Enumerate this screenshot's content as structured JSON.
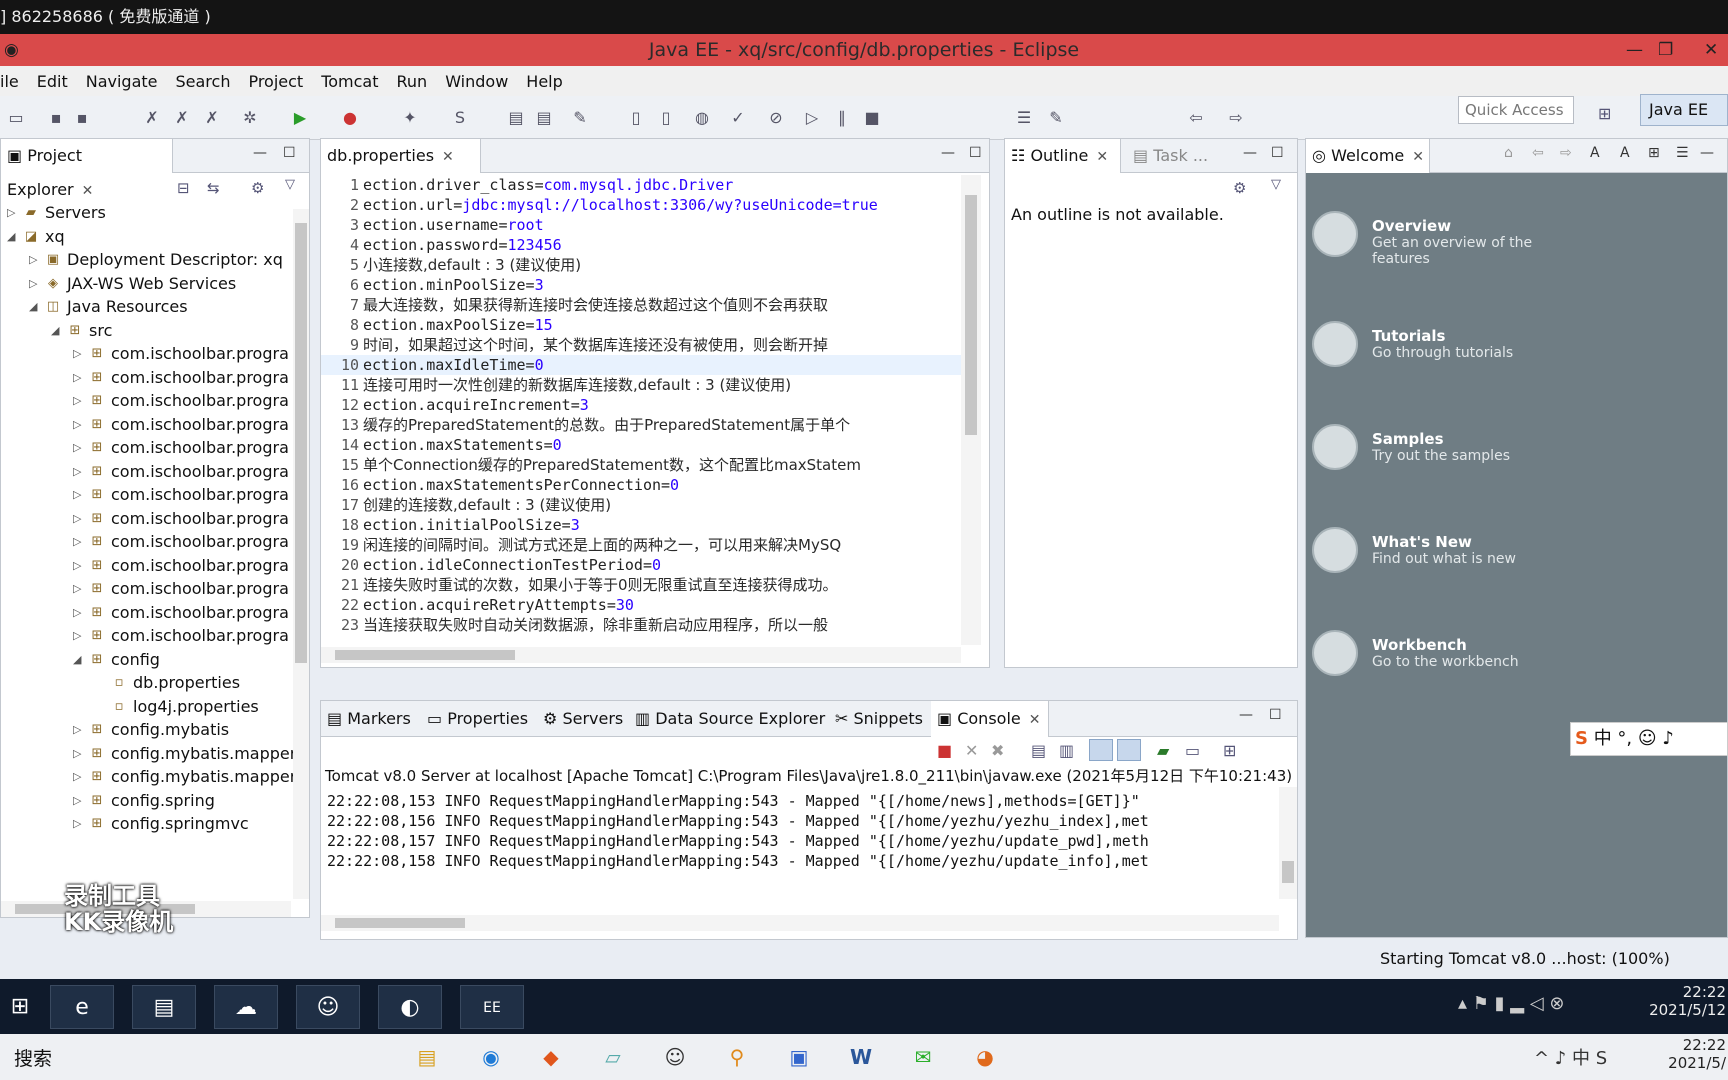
{
  "top_strip": {
    "text": "] 862258686 ( 免费版通道 )"
  },
  "window": {
    "title": "Java EE - xq/src/config/db.properties - Eclipse"
  },
  "menu": [
    "ile",
    "Edit",
    "Navigate",
    "Search",
    "Project",
    "Tomcat",
    "Run",
    "Window",
    "Help"
  ],
  "toolbar": {
    "quick_access_placeholder": "Quick Access",
    "perspective": "Java EE"
  },
  "project_explorer": {
    "tab": "Project Explorer",
    "items": [
      {
        "label": "Servers",
        "icon": "folder-icon"
      },
      {
        "label": "xq",
        "icon": "project-icon"
      },
      {
        "label": "Deployment Descriptor: xq",
        "icon": "descriptor-icon"
      },
      {
        "label": "JAX-WS Web Services",
        "icon": "webservice-icon"
      },
      {
        "label": "Java Resources",
        "icon": "java-resources-icon"
      },
      {
        "label": "src",
        "icon": "source-folder-icon"
      },
      {
        "label": "com.ischoolbar.progra",
        "icon": "package-icon"
      },
      {
        "label": "com.ischoolbar.progra",
        "icon": "package-icon"
      },
      {
        "label": "com.ischoolbar.progra",
        "icon": "package-icon"
      },
      {
        "label": "com.ischoolbar.progra",
        "icon": "package-icon"
      },
      {
        "label": "com.ischoolbar.progra",
        "icon": "package-icon"
      },
      {
        "label": "com.ischoolbar.progra",
        "icon": "package-icon"
      },
      {
        "label": "com.ischoolbar.progra",
        "icon": "package-icon"
      },
      {
        "label": "com.ischoolbar.progra",
        "icon": "package-icon"
      },
      {
        "label": "com.ischoolbar.progra",
        "icon": "package-icon"
      },
      {
        "label": "com.ischoolbar.progra",
        "icon": "package-icon"
      },
      {
        "label": "com.ischoolbar.progra",
        "icon": "package-icon"
      },
      {
        "label": "com.ischoolbar.progra",
        "icon": "package-icon"
      },
      {
        "label": "com.ischoolbar.progra",
        "icon": "package-icon"
      },
      {
        "label": "config",
        "icon": "package-icon"
      },
      {
        "label": "db.properties",
        "icon": "file-icon"
      },
      {
        "label": "log4j.properties",
        "icon": "file-icon"
      },
      {
        "label": "config.mybatis",
        "icon": "package-icon"
      },
      {
        "label": "config.mybatis.mapper",
        "icon": "package-icon"
      },
      {
        "label": "config.mybatis.mapper",
        "icon": "package-icon"
      },
      {
        "label": "config.spring",
        "icon": "package-icon"
      },
      {
        "label": "config.springmvc",
        "icon": "package-icon"
      }
    ]
  },
  "editor": {
    "tab": "db.properties",
    "lines": [
      {
        "n": "1",
        "k": "ection.driver_class=",
        "v": "com.mysql.jdbc.Driver"
      },
      {
        "n": "2",
        "k": "ection.url=",
        "v": "jdbc:mysql://localhost:3306/wy?useUnicode=true"
      },
      {
        "n": "3",
        "k": "ection.username=",
        "v": "root"
      },
      {
        "n": "4",
        "k": "ection.password=",
        "v": "123456"
      },
      {
        "n": "5",
        "c": "小连接数,default : 3 (建议使用)"
      },
      {
        "n": "6",
        "k": "ection.minPoolSize=",
        "v": "3"
      },
      {
        "n": "7",
        "c": "最大连接数，如果获得新连接时会使连接总数超过这个值则不会再获取"
      },
      {
        "n": "8",
        "k": "ection.maxPoolSize=",
        "v": "15"
      },
      {
        "n": "9",
        "c": "时间，如果超过这个时间，某个数据库连接还没有被使用，则会断开掉"
      },
      {
        "n": "10",
        "k": "ection.maxIdleTime=",
        "v": "0"
      },
      {
        "n": "11",
        "c": "连接可用时一次性创建的新数据库连接数,default : 3 (建议使用)"
      },
      {
        "n": "12",
        "k": "ection.acquireIncrement=",
        "v": "3"
      },
      {
        "n": "13",
        "c": "缓存的PreparedStatement的总数。由于PreparedStatement属于单个"
      },
      {
        "n": "14",
        "k": "ection.maxStatements=",
        "v": "0"
      },
      {
        "n": "15",
        "c": "单个Connection缓存的PreparedStatement数，这个配置比maxStatem"
      },
      {
        "n": "16",
        "k": "ection.maxStatementsPerConnection=",
        "v": "0"
      },
      {
        "n": "17",
        "c": "创建的连接数,default : 3 (建议使用)"
      },
      {
        "n": "18",
        "k": "ection.initialPoolSize=",
        "v": "3"
      },
      {
        "n": "19",
        "c": "闲连接的间隔时间。测试方式还是上面的两种之一，可以用来解决MySQ"
      },
      {
        "n": "20",
        "k": "ection.idleConnectionTestPeriod=",
        "v": "0"
      },
      {
        "n": "21",
        "c": "连接失败时重试的次数，如果小于等于0则无限重试直至连接获得成功。"
      },
      {
        "n": "22",
        "k": "ection.acquireRetryAttempts=",
        "v": "30"
      },
      {
        "n": "23",
        "c": "当连接获取失败时自动关闭数据源，除非重新启动应用程序，所以一般"
      }
    ]
  },
  "outline": {
    "tab": "Outline",
    "tab2": "Task ...",
    "message": "An outline is not available."
  },
  "welcome": {
    "tab": "Welcome",
    "items": [
      {
        "title": "Overview",
        "desc": "Get an overview of the features"
      },
      {
        "title": "Tutorials",
        "desc": "Go through tutorials"
      },
      {
        "title": "Samples",
        "desc": "Try out the samples"
      },
      {
        "title": "What's New",
        "desc": "Find out what is new"
      },
      {
        "title": "Workbench",
        "desc": "Go to the workbench"
      }
    ]
  },
  "bottom_tabs": [
    "Markers",
    "Properties",
    "Servers",
    "Data Source Explorer",
    "Snippets",
    "Console"
  ],
  "console": {
    "header": "Tomcat v8.0 Server at localhost [Apache Tomcat] C:\\Program Files\\Java\\jre1.8.0_211\\bin\\javaw.exe (2021年5月12日 下午10:21:43)",
    "lines": [
      "22:22:08,153  INFO RequestMappingHandlerMapping:543 - Mapped \"{[/home/news],methods=[GET]}\"",
      "22:22:08,156  INFO RequestMappingHandlerMapping:543 - Mapped \"{[/home/yezhu/yezhu_index],met",
      "22:22:08,157  INFO RequestMappingHandlerMapping:543 - Mapped \"{[/home/yezhu/update_pwd],meth",
      "22:22:08,158  INFO RequestMappingHandlerMapping:543 - Mapped \"{[/home/yezhu/update_info],met"
    ]
  },
  "status": "Starting Tomcat v8.0 ...host: (100%)",
  "watermark": {
    "line1": "录制工具",
    "line2": "KK录像机"
  },
  "taskbar1": {
    "time": "22:22",
    "date": "2021/5/12"
  },
  "taskbar2": {
    "search": "搜索",
    "time": "22:22",
    "date": "2021/5/"
  },
  "ime": "中 °,"
}
